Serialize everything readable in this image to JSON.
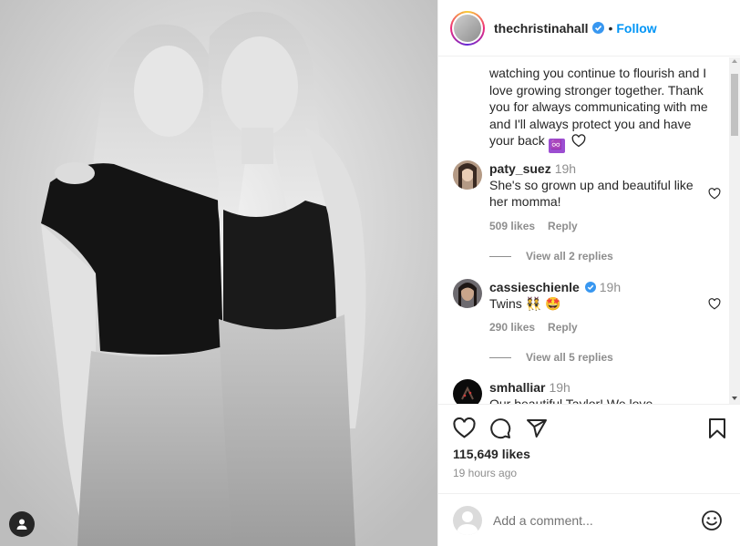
{
  "post": {
    "username": "thechristinahall",
    "follow_label": "Follow",
    "dot": "•"
  },
  "caption": {
    "line1": "watching you continue to flourish and I",
    "line2": "love growing stronger together. Thank",
    "line3": "you for always communicating with me",
    "line4": "and I'll always protect you and have",
    "line5": "your back",
    "emoji_label": "♾️"
  },
  "comments": [
    {
      "user": "paty_suez",
      "time": "19h",
      "text": "She's so grown up and beautiful like her momma!",
      "likes": "509 likes",
      "reply": "Reply",
      "view_replies": "View all 2 replies"
    },
    {
      "user": "cassieschienle",
      "time": "19h",
      "text": "Twins 👯 🤩",
      "likes": "290 likes",
      "reply": "Reply",
      "view_replies": "View all 5 replies"
    },
    {
      "user": "smhalliar",
      "time": "19h",
      "text": "Our beautiful Taylor! We love..."
    }
  ],
  "stats": {
    "likes": "115,649 likes",
    "ago": "19 hours ago"
  },
  "comment_box": {
    "placeholder": "Add a comment..."
  },
  "icons": {
    "like": "heart-icon",
    "comment": "comment-icon",
    "share": "share-icon",
    "save": "bookmark-icon",
    "emoji": "emoji-icon",
    "tag": "user-tag-icon",
    "verified": "verified-badge-icon"
  },
  "colors": {
    "accent": "#0095f6",
    "verified": "#3897f0",
    "muted": "#8e8e8e",
    "text": "#262626"
  }
}
